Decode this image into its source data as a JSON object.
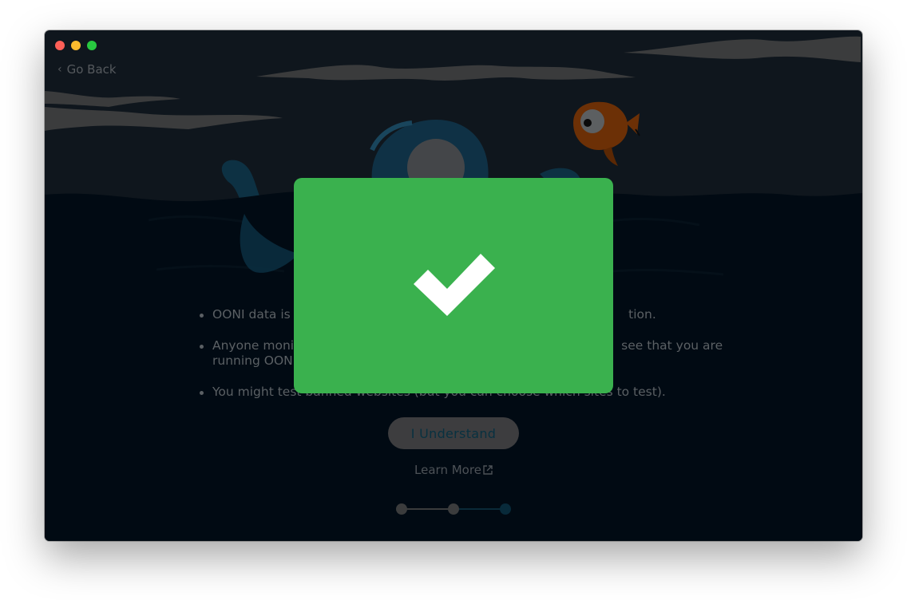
{
  "window": {
    "traffic_lights": [
      "close",
      "minimize",
      "zoom"
    ]
  },
  "nav": {
    "go_back_label": "Go Back",
    "chevron_icon": "chevron-left-icon"
  },
  "content": {
    "bullets": [
      "OONI data is c",
      "tion.",
      "Anyone monit",
      "see that you are",
      "running OONI",
      "You might test banned websites (but you can choose which sites to test)."
    ]
  },
  "actions": {
    "understand_label": "I Understand",
    "learn_more_label": "Learn More",
    "external_link_icon": "external-link-icon"
  },
  "stepper": {
    "total_steps": 3,
    "current_step": 3
  },
  "modal": {
    "icon": "checkmark-icon",
    "color": "#3ab14e"
  },
  "colors": {
    "background": "#0f161d",
    "water": "#010a13",
    "success": "#3ab14e"
  }
}
